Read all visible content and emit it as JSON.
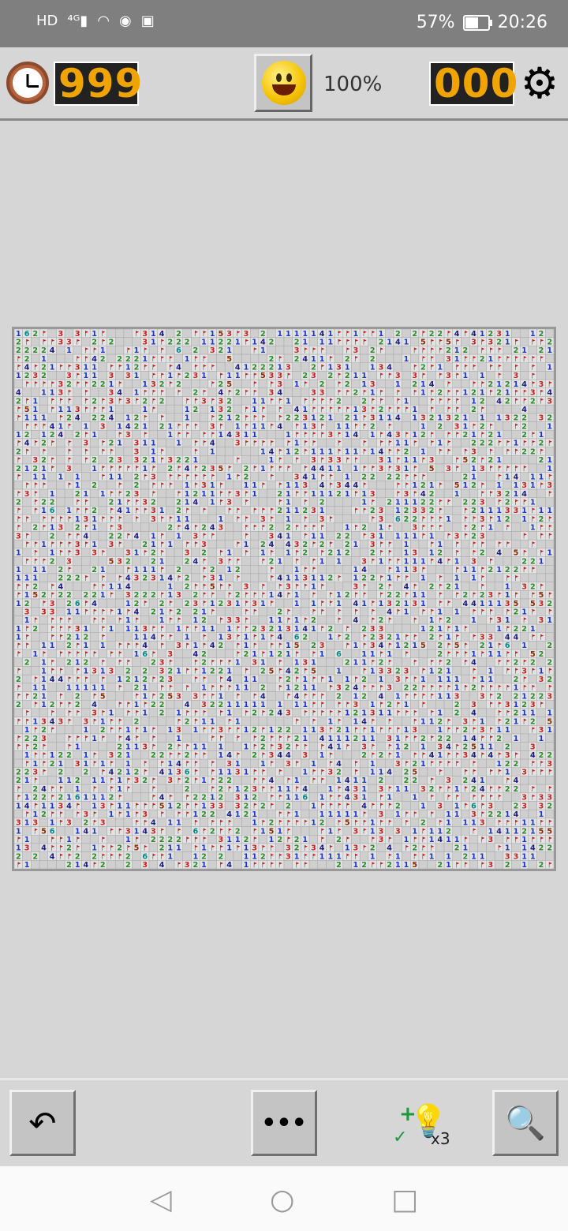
{
  "status_bar": {
    "left_icons": [
      "hd-icon",
      "signal-4g-icon",
      "wifi-icon",
      "eye-icon",
      "app-icon"
    ],
    "battery_percent": "57%",
    "battery_level": 0.57,
    "time": "20:26"
  },
  "header": {
    "timer": "999",
    "zoom": "100%",
    "mines": "000",
    "icons": [
      "clock-icon",
      "smiley-icon",
      "gear-icon"
    ]
  },
  "board": {
    "rows": 64,
    "cols": 64,
    "number_colors": {
      "1": "#1c36c8",
      "2": "#2a8a2a",
      "3": "#c82020",
      "4": "#1a1a80",
      "5": "#8a2a00",
      "6": "#008a8a"
    }
  },
  "toolbar": {
    "undo_icon": "undo-arrow-icon",
    "more_label": "•••",
    "hint_count": "x3",
    "search_icon": "magnifier-icon"
  },
  "nav": {
    "back_icon": "back-triangle-icon",
    "home_icon": "home-circle-icon",
    "recents_icon": "recents-square-icon"
  }
}
